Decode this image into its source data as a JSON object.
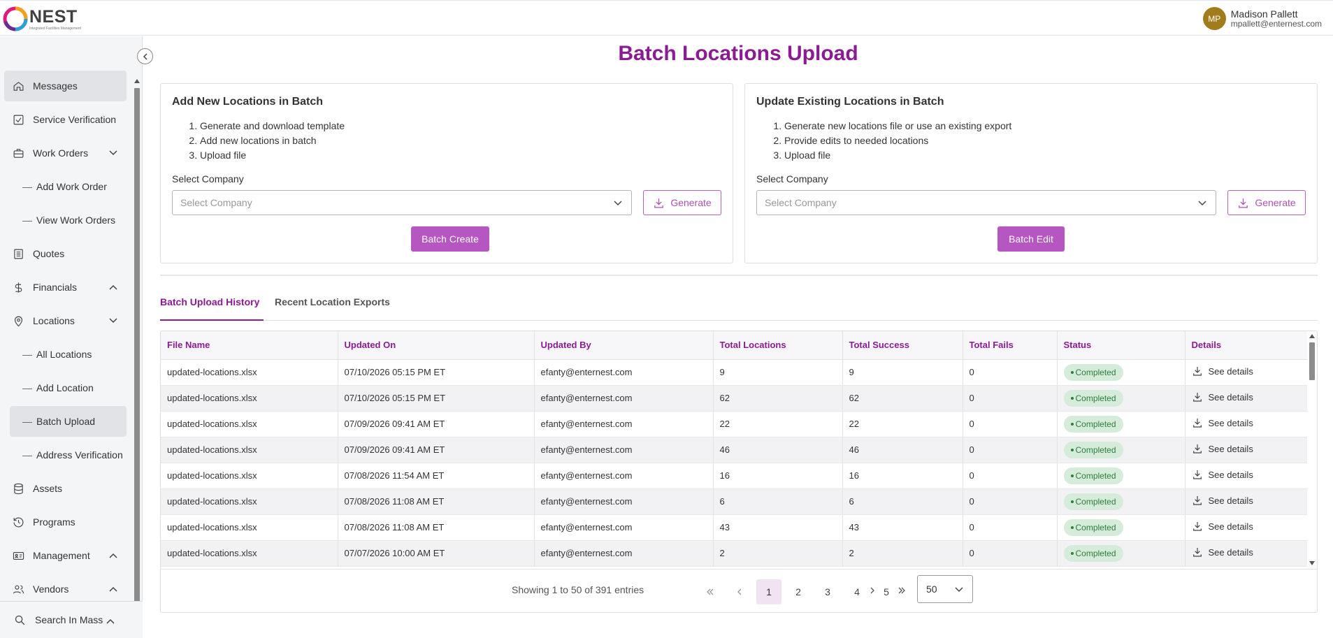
{
  "brand": {
    "name": "NEST",
    "tagline": "Integrated Facilities Management"
  },
  "user": {
    "initials": "MP",
    "name": "Madison Pallett",
    "email": "mpallett@enternest.com"
  },
  "sidebar": {
    "items": [
      {
        "label": "Messages",
        "icon": "home-icon",
        "type": "item",
        "active": true
      },
      {
        "label": "Service Verification",
        "icon": "checkbox-icon",
        "type": "item"
      },
      {
        "label": "Work Orders",
        "icon": "briefcase-icon",
        "type": "item",
        "chevron": "down"
      },
      {
        "label": "Add Work Order",
        "type": "sub"
      },
      {
        "label": "View Work Orders",
        "type": "sub"
      },
      {
        "label": "Quotes",
        "icon": "document-icon",
        "type": "item"
      },
      {
        "label": "Financials",
        "icon": "dollar-icon",
        "type": "item",
        "chevron": "up"
      },
      {
        "label": "Locations",
        "icon": "location-pin-icon",
        "type": "item",
        "chevron": "down"
      },
      {
        "label": "All Locations",
        "type": "sub"
      },
      {
        "label": "Add Location",
        "type": "sub"
      },
      {
        "label": "Batch Upload",
        "type": "sub",
        "active": true
      },
      {
        "label": "Address Verification",
        "type": "sub"
      },
      {
        "label": "Assets",
        "icon": "database-icon",
        "type": "item"
      },
      {
        "label": "Programs",
        "icon": "history-icon",
        "type": "item"
      },
      {
        "label": "Management",
        "icon": "id-card-icon",
        "type": "item",
        "chevron": "up"
      },
      {
        "label": "Vendors",
        "icon": "users-icon",
        "type": "item",
        "chevron": "up"
      }
    ],
    "footer": {
      "label": "Search In Mass",
      "icon": "search-icon"
    }
  },
  "page": {
    "title": "Batch Locations Upload"
  },
  "add_card": {
    "title": "Add New Locations in Batch",
    "steps": [
      "Generate and download template",
      "Add new locations in batch",
      "Upload file"
    ],
    "select_label": "Select Company",
    "select_placeholder": "Select Company",
    "generate_label": "Generate",
    "action_label": "Batch Create"
  },
  "update_card": {
    "title": "Update Existing Locations in Batch",
    "steps": [
      "Generate new locations file or use an existing export",
      "Provide edits to needed locations",
      "Upload file"
    ],
    "select_label": "Select Company",
    "select_placeholder": "Select Company",
    "generate_label": "Generate",
    "action_label": "Batch Edit"
  },
  "tabs": [
    {
      "label": "Batch Upload History",
      "active": true
    },
    {
      "label": "Recent Location Exports",
      "active": false
    }
  ],
  "table": {
    "columns": [
      "File Name",
      "Updated On",
      "Updated By",
      "Total Locations",
      "Total Success",
      "Total Fails",
      "Status",
      "Details"
    ],
    "rows": [
      {
        "file": "updated-locations.xlsx",
        "updated_on": "07/10/2026 05:15 PM ET",
        "updated_by": "efanty@enternest.com",
        "total": "9",
        "success": "9",
        "fails": "0",
        "status": "Completed",
        "details": "See details"
      },
      {
        "file": "updated-locations.xlsx",
        "updated_on": "07/10/2026 05:15 PM ET",
        "updated_by": "efanty@enternest.com",
        "total": "62",
        "success": "62",
        "fails": "0",
        "status": "Completed",
        "details": "See details"
      },
      {
        "file": "updated-locations.xlsx",
        "updated_on": "07/09/2026 09:41 AM ET",
        "updated_by": "efanty@enternest.com",
        "total": "22",
        "success": "22",
        "fails": "0",
        "status": "Completed",
        "details": "See details"
      },
      {
        "file": "updated-locations.xlsx",
        "updated_on": "07/09/2026 09:41 AM ET",
        "updated_by": "efanty@enternest.com",
        "total": "46",
        "success": "46",
        "fails": "0",
        "status": "Completed",
        "details": "See details"
      },
      {
        "file": "updated-locations.xlsx",
        "updated_on": "07/08/2026 11:54 AM ET",
        "updated_by": "efanty@enternest.com",
        "total": "16",
        "success": "16",
        "fails": "0",
        "status": "Completed",
        "details": "See details"
      },
      {
        "file": "updated-locations.xlsx",
        "updated_on": "07/08/2026 11:08 AM ET",
        "updated_by": "efanty@enternest.com",
        "total": "6",
        "success": "6",
        "fails": "0",
        "status": "Completed",
        "details": "See details"
      },
      {
        "file": "updated-locations.xlsx",
        "updated_on": "07/08/2026 11:08 AM ET",
        "updated_by": "efanty@enternest.com",
        "total": "43",
        "success": "43",
        "fails": "0",
        "status": "Completed",
        "details": "See details"
      },
      {
        "file": "updated-locations.xlsx",
        "updated_on": "07/07/2026 10:00 AM ET",
        "updated_by": "efanty@enternest.com",
        "total": "2",
        "success": "2",
        "fails": "0",
        "status": "Completed",
        "details": "See details"
      }
    ]
  },
  "pagination": {
    "showing": "Showing 1 to 50 of 391 entries",
    "pages": [
      "1",
      "2",
      "3",
      "4",
      "5"
    ],
    "current": "1",
    "page_size": "50"
  },
  "colors": {
    "accent": "#8b1b93",
    "button": "#b556c1",
    "success_bg": "#d4ecd9",
    "success_text": "#2f7d3c"
  }
}
